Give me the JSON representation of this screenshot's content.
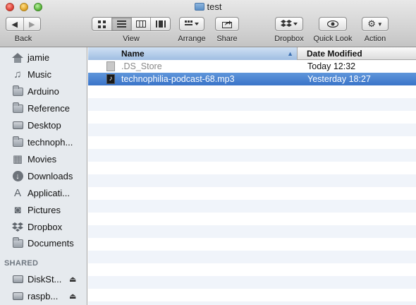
{
  "window": {
    "title": "test"
  },
  "toolbar": {
    "back_label": "Back",
    "view_label": "View",
    "arrange_label": "Arrange",
    "share_label": "Share",
    "dropbox_label": "Dropbox",
    "quicklook_label": "Quick Look",
    "action_label": "Action",
    "view_modes": [
      "icon-view",
      "list-view",
      "column-view",
      "coverflow-view"
    ],
    "selected_view": "list-view"
  },
  "sidebar": {
    "favorites": [
      {
        "label": "jamie",
        "icon": "home-icon"
      },
      {
        "label": "Music",
        "icon": "music-icon"
      },
      {
        "label": "Arduino",
        "icon": "folder-icon"
      },
      {
        "label": "Reference",
        "icon": "folder-icon"
      },
      {
        "label": "Desktop",
        "icon": "desktop-icon"
      },
      {
        "label": "technoph...",
        "icon": "folder-icon"
      },
      {
        "label": "Movies",
        "icon": "movies-icon"
      },
      {
        "label": "Downloads",
        "icon": "downloads-icon"
      },
      {
        "label": "Applicati...",
        "icon": "applications-icon"
      },
      {
        "label": "Pictures",
        "icon": "camera-icon"
      },
      {
        "label": "Dropbox",
        "icon": "dropbox-icon"
      },
      {
        "label": "Documents",
        "icon": "folder-icon"
      }
    ],
    "shared_heading": "SHARED",
    "shared": [
      {
        "label": "DiskSt...",
        "icon": "network-disk-icon"
      },
      {
        "label": "raspb...",
        "icon": "network-disk-icon"
      }
    ]
  },
  "list": {
    "columns": {
      "name": "Name",
      "date": "Date Modified"
    },
    "sort_indicator": "▲",
    "rows": [
      {
        "name": ".DS_Store",
        "date": "Today 12:32",
        "icon": "document-icon",
        "hidden": true,
        "selected": false
      },
      {
        "name": "technophilia-podcast-68.mp3",
        "date": "Yesterday 18:27",
        "icon": "mp3-icon",
        "hidden": false,
        "selected": true
      }
    ]
  },
  "colors": {
    "selection": "#3a74c8",
    "sidebar_bg": "#e6eaee",
    "header_active": "#9fbde2"
  }
}
